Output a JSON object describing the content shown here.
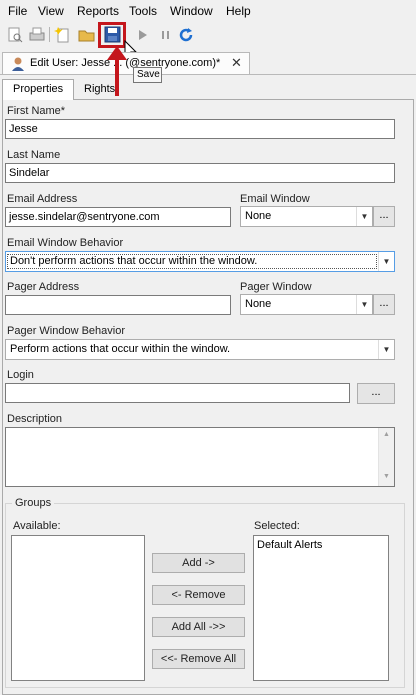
{
  "menu": {
    "items": [
      "File",
      "View",
      "Reports",
      "Tools",
      "Window",
      "Help"
    ]
  },
  "toolbar": {
    "icons": [
      "print-preview-icon",
      "print-icon",
      "new-icon",
      "open-folder-icon",
      "save-icon",
      "run-icon",
      "pause-icon",
      "refresh-icon"
    ],
    "tooltip": "Save"
  },
  "doc_tab": {
    "title": "Edit User: Jesse ... (@sentryone.com)*",
    "close": "✕"
  },
  "inner_tabs": {
    "properties": "Properties",
    "rights": "Rights"
  },
  "form": {
    "first_name_label": "First Name*",
    "first_name_value": "Jesse",
    "last_name_label": "Last Name",
    "last_name_value": "Sindelar",
    "email_address_label": "Email Address",
    "email_address_value": "jesse.sindelar@sentryone.com",
    "email_window_label": "Email Window",
    "email_window_value": "None",
    "email_window_behavior_label": "Email Window Behavior",
    "email_window_behavior_value": "Don't perform actions that occur within the window.",
    "pager_address_label": "Pager Address",
    "pager_address_value": "",
    "pager_window_label": "Pager Window",
    "pager_window_value": "None",
    "pager_window_behavior_label": "Pager Window Behavior",
    "pager_window_behavior_value": "Perform actions that occur within the window.",
    "login_label": "Login",
    "login_value": "",
    "description_label": "Description",
    "ellipsis": "..."
  },
  "groups": {
    "title": "Groups",
    "available_label": "Available:",
    "selected_label": "Selected:",
    "selected_items": [
      "Default Alerts"
    ],
    "add_label": "Add ->",
    "remove_label": "<- Remove",
    "add_all_label": "Add All ->>",
    "remove_all_label": "<<- Remove All"
  },
  "colors": {
    "highlight": "#c4161c"
  }
}
